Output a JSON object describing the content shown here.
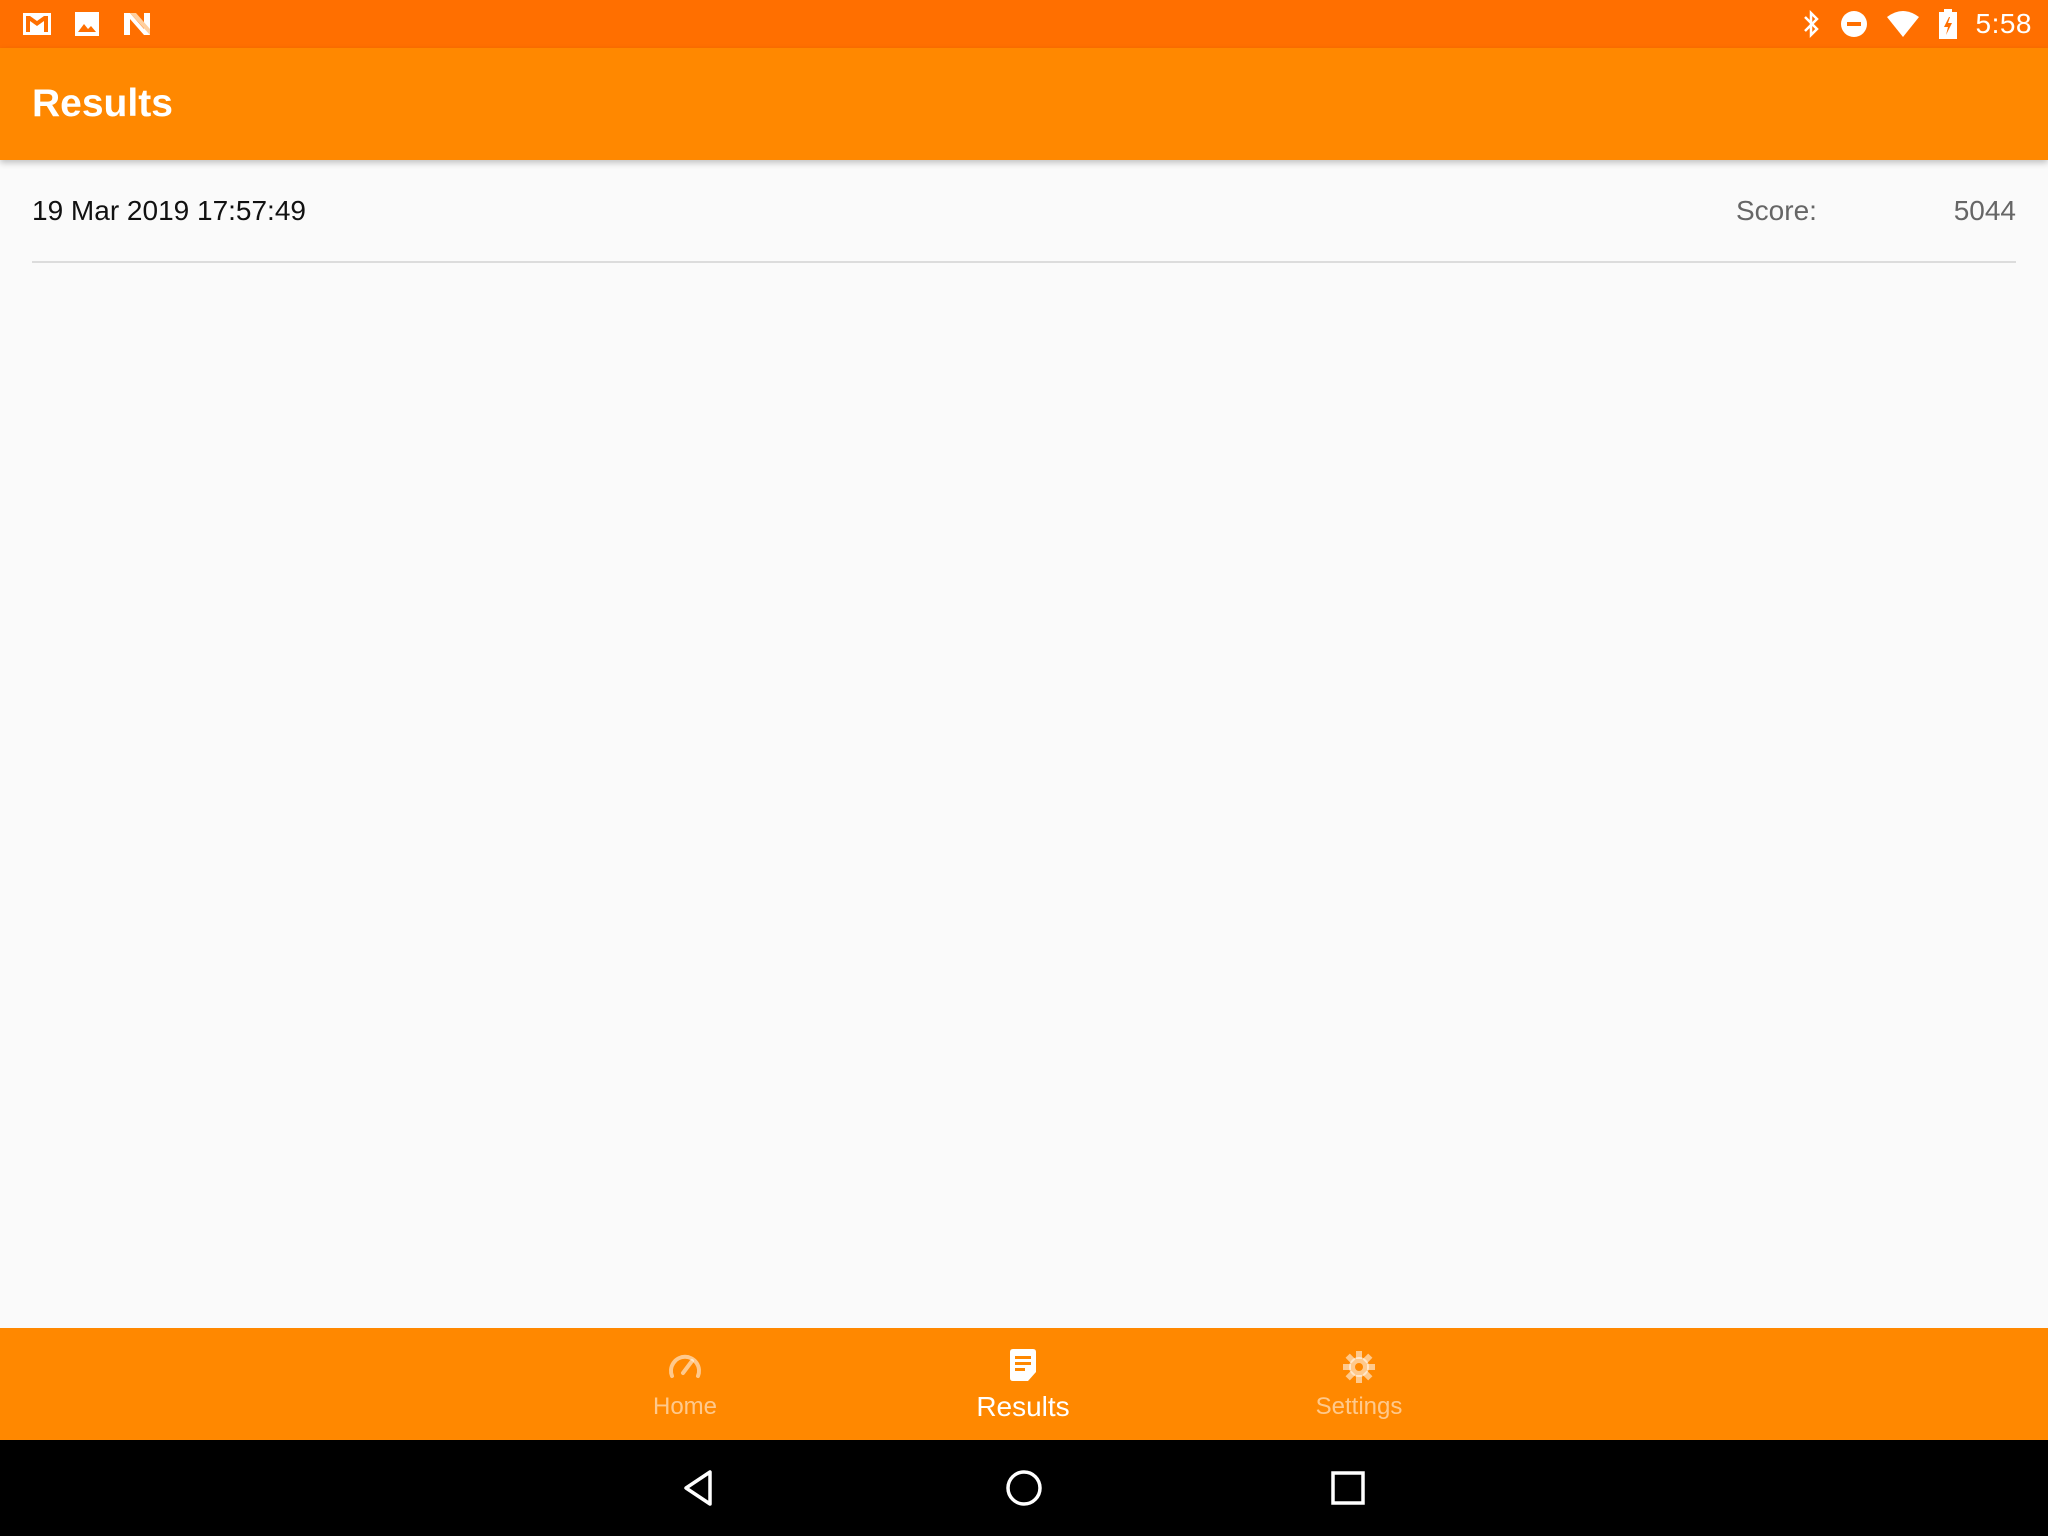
{
  "status_bar": {
    "left_icons": [
      "gmail-icon",
      "photos-icon",
      "notification-n-icon"
    ],
    "right_icons": [
      "bluetooth-icon",
      "do-not-disturb-icon",
      "wifi-icon",
      "battery-charging-icon"
    ],
    "time": "5:58"
  },
  "app_bar": {
    "title": "Results"
  },
  "results": [
    {
      "date": "19 Mar 2019 17:57:49",
      "score_label": "Score:",
      "score_value": "5044"
    }
  ],
  "bottom_nav": {
    "items": [
      {
        "label": "Home",
        "icon": "speedometer-icon",
        "active": false
      },
      {
        "label": "Results",
        "icon": "document-icon",
        "active": true
      },
      {
        "label": "Settings",
        "icon": "gear-icon",
        "active": false
      }
    ]
  },
  "system_nav": {
    "buttons": [
      "back-icon",
      "home-circle-icon",
      "recents-icon"
    ]
  },
  "colors": {
    "status_bar": "#ff6f00",
    "primary": "#ff8800",
    "background": "#fafafa",
    "divider": "#dcdcdc"
  }
}
